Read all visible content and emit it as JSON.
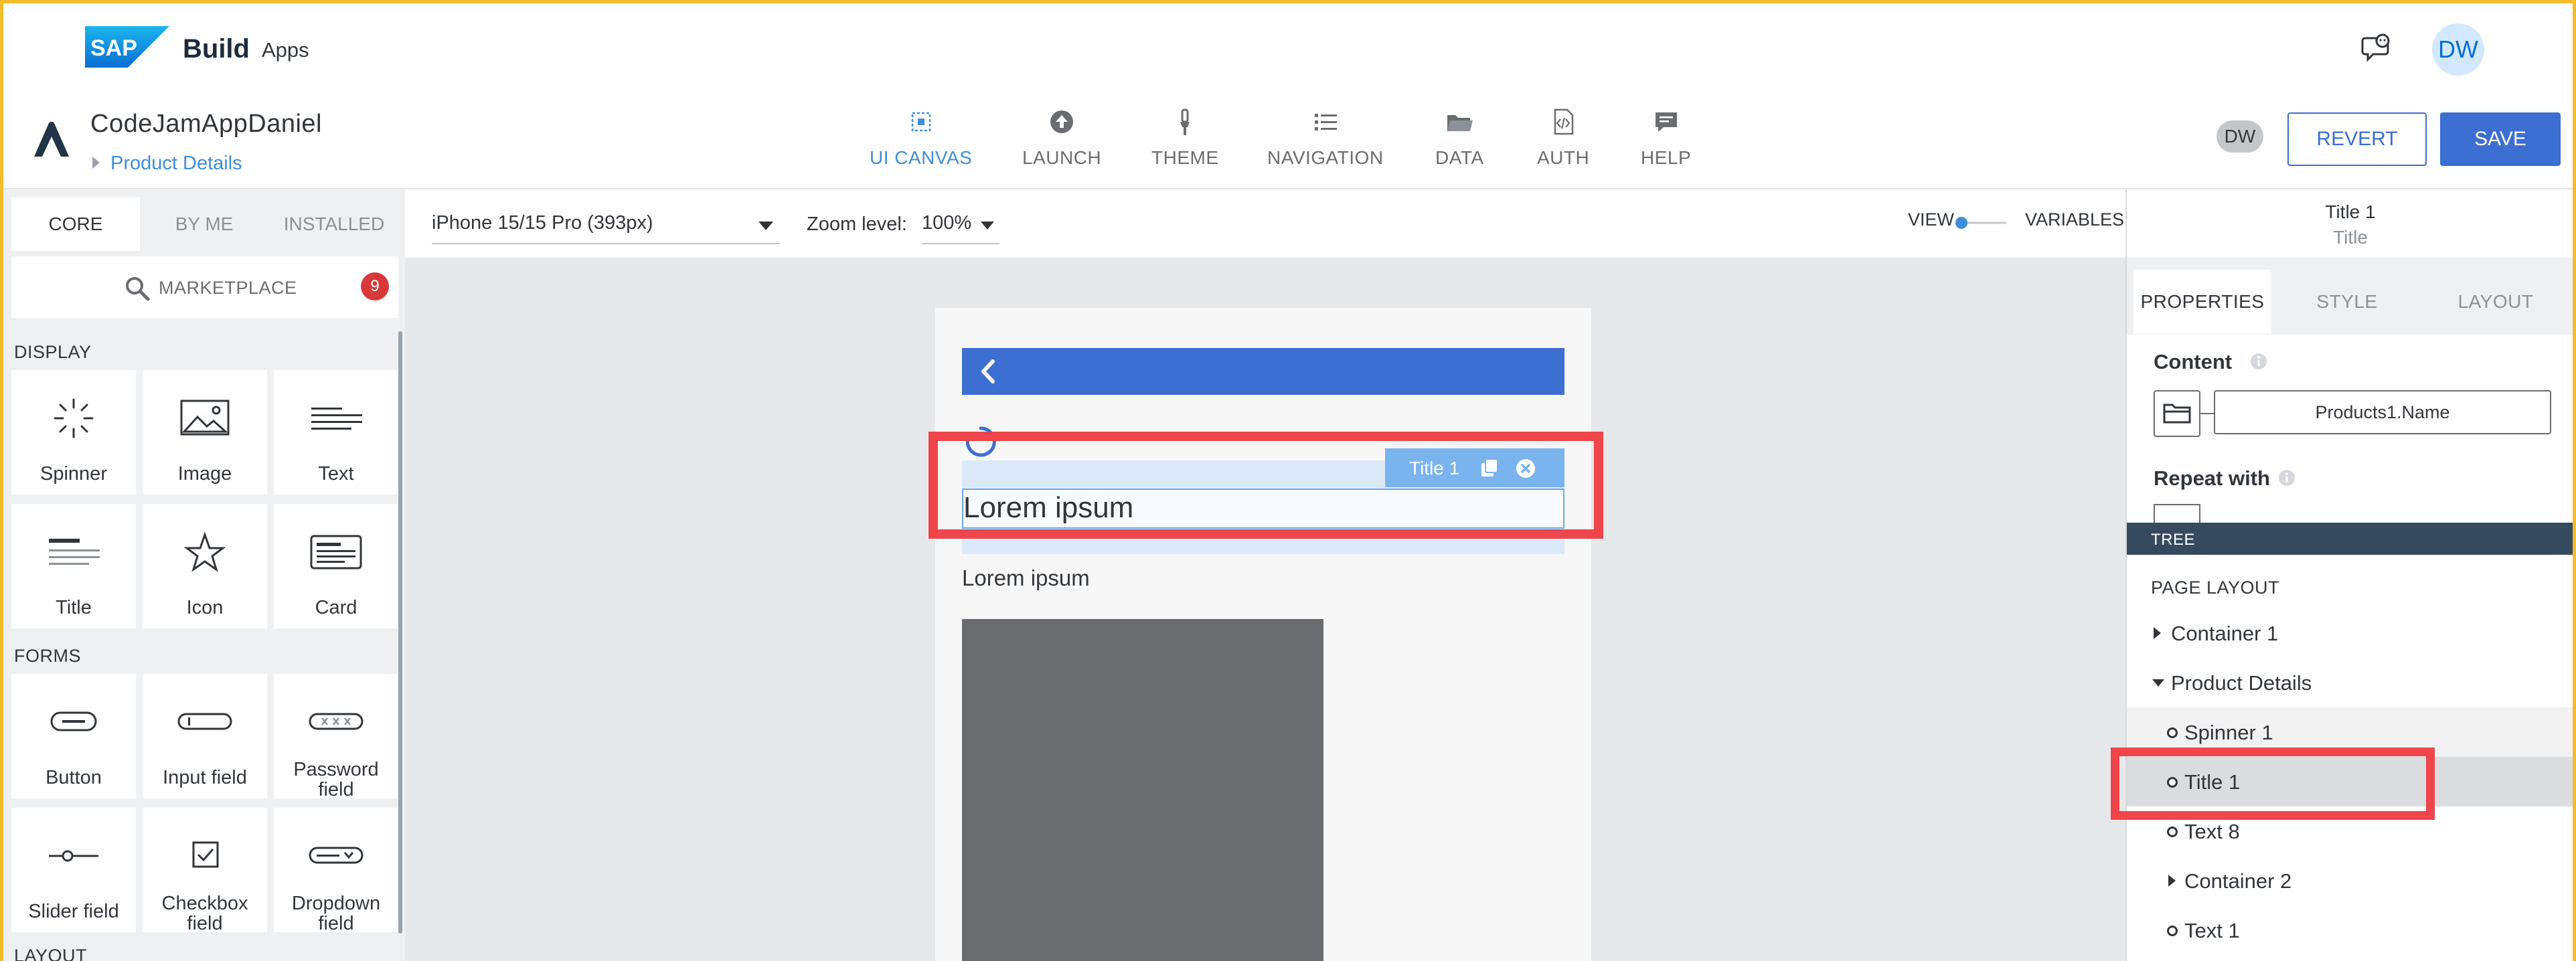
{
  "shell": {
    "logo_text": "SAP",
    "product": "Build",
    "product_sub": "Apps",
    "avatar": "DW",
    "icons": [
      "sap-logo",
      "feedback-icon"
    ]
  },
  "header": {
    "app_name": "CodeJamAppDaniel",
    "current_page": "Product Details",
    "nav": [
      {
        "label": "UI CANVAS",
        "icon": "grid-icon",
        "active": true
      },
      {
        "label": "LAUNCH",
        "icon": "upload-icon"
      },
      {
        "label": "THEME",
        "icon": "brush-icon"
      },
      {
        "label": "NAVIGATION",
        "icon": "list-icon"
      },
      {
        "label": "DATA",
        "icon": "folder-icon"
      },
      {
        "label": "AUTH",
        "icon": "code-file-icon"
      },
      {
        "label": "HELP",
        "icon": "chat-icon"
      }
    ],
    "avatar": "DW",
    "revert_label": "REVERT",
    "save_label": "SAVE"
  },
  "left_panel": {
    "tabs": [
      "CORE",
      "BY ME",
      "INSTALLED"
    ],
    "active_tab": "CORE",
    "marketplace_label": "MARKETPLACE",
    "marketplace_badge": "9",
    "sections": [
      {
        "title": "DISPLAY",
        "items": [
          "Spinner",
          "Image",
          "Text",
          "Title",
          "Icon",
          "Card"
        ]
      },
      {
        "title": "FORMS",
        "items": [
          "Button",
          "Input field",
          "Password field",
          "Slider field",
          "Checkbox field",
          "Dropdown field"
        ]
      },
      {
        "title": "LAYOUT",
        "items": []
      }
    ]
  },
  "canvas_toolbar": {
    "device": "iPhone 15/15 Pro (393px)",
    "zoom_label": "Zoom level:",
    "zoom_value": "100%",
    "view_label": "VIEW",
    "variables_label": "VARIABLES"
  },
  "canvas": {
    "selected_tag": "Title 1",
    "title_text": "Lorem ipsum",
    "text8": "Lorem ipsum"
  },
  "right_panel": {
    "selected_name": "Title 1",
    "selected_type": "Title",
    "tabs": [
      "PROPERTIES",
      "STYLE",
      "LAYOUT"
    ],
    "active_tab": "PROPERTIES",
    "content_label": "Content",
    "content_binding": "Products1.Name",
    "repeat_label": "Repeat with",
    "tree_header": "TREE",
    "tree_title": "PAGE LAYOUT",
    "tree": [
      {
        "label": "Container 1",
        "kind": "collapsed",
        "indent": 0
      },
      {
        "label": "Product Details",
        "kind": "expanded",
        "indent": 0
      },
      {
        "label": "Spinner 1",
        "kind": "leaf",
        "indent": 1
      },
      {
        "label": "Title 1",
        "kind": "leaf",
        "indent": 1,
        "selected": true
      },
      {
        "label": "Text 8",
        "kind": "leaf",
        "indent": 1
      },
      {
        "label": "Container 2",
        "kind": "collapsed",
        "indent": 1
      },
      {
        "label": "Text 1",
        "kind": "leaf",
        "indent": 1
      }
    ]
  },
  "colors": {
    "accent": "#3d6ed1",
    "highlight": "#f0454a",
    "frame": "#f3bc2c",
    "tree_header": "#354a5f"
  }
}
